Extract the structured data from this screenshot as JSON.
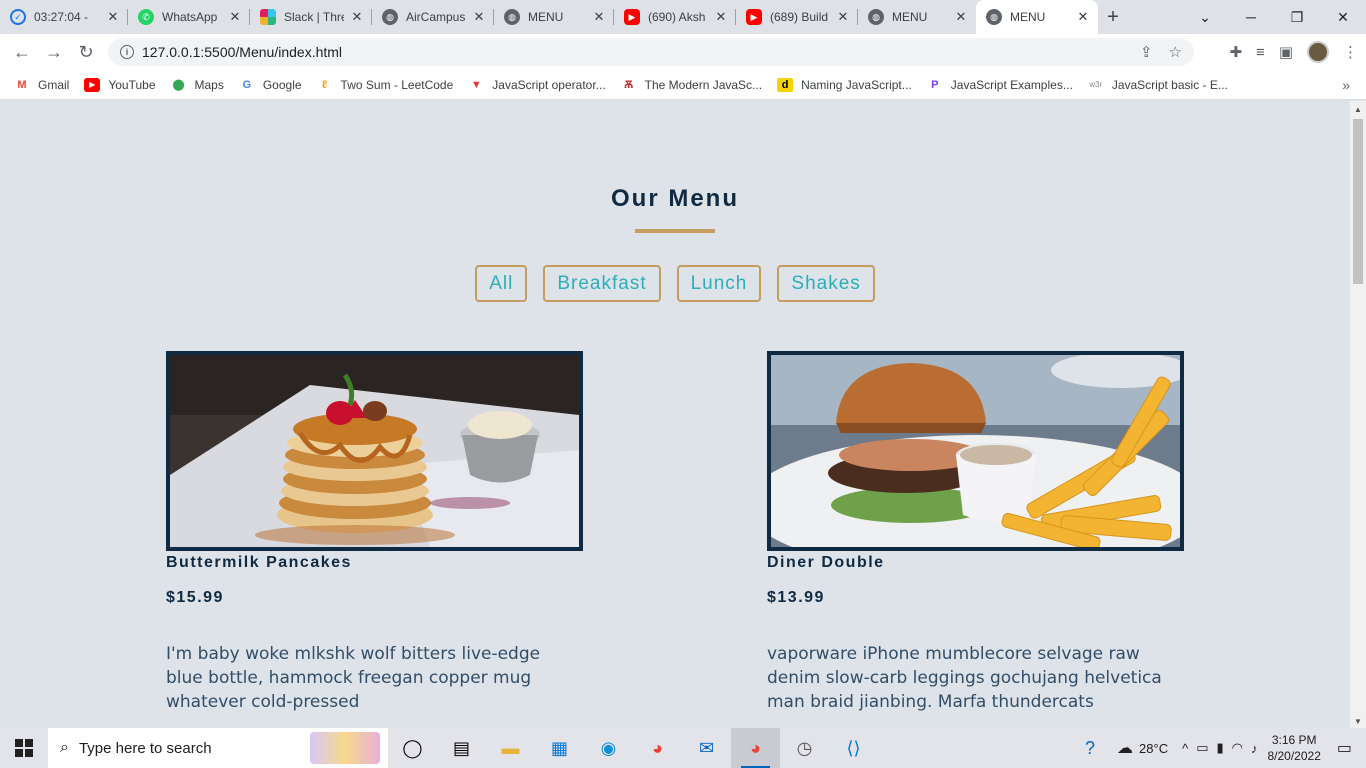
{
  "browser": {
    "tabs": [
      {
        "title": "03:27:04 -",
        "icon": "clock-check-icon",
        "color": "#1a73e8",
        "active": false
      },
      {
        "title": "WhatsApp",
        "icon": "whatsapp-icon",
        "color": "#25d366",
        "active": false
      },
      {
        "title": "Slack | Thre",
        "icon": "slack-icon",
        "color": "#e01e5a",
        "active": false
      },
      {
        "title": "AirCampus",
        "icon": "globe-icon",
        "color": "#5f6368",
        "active": false
      },
      {
        "title": "MENU",
        "icon": "globe-icon",
        "color": "#5f6368",
        "active": false
      },
      {
        "title": "(690) Aksh",
        "icon": "youtube-icon",
        "color": "#ff0000",
        "active": false
      },
      {
        "title": "(689) Build",
        "icon": "youtube-icon",
        "color": "#ff0000",
        "active": false
      },
      {
        "title": "MENU",
        "icon": "globe-icon",
        "color": "#5f6368",
        "active": false
      },
      {
        "title": "MENU",
        "icon": "globe-icon",
        "color": "#5f6368",
        "active": true
      }
    ],
    "url": "127.0.0.1:5500/Menu/index.html",
    "bookmarks": [
      {
        "label": "Gmail",
        "icon": "gmail-icon",
        "color": "#ea4335"
      },
      {
        "label": "YouTube",
        "icon": "youtube-icon",
        "color": "#ff0000"
      },
      {
        "label": "Maps",
        "icon": "maps-pin-icon",
        "color": "#34a853"
      },
      {
        "label": "Google",
        "icon": "google-icon",
        "color": "#4285f4"
      },
      {
        "label": "Two Sum - LeetCode",
        "icon": "leetcode-icon",
        "color": "#ffa116"
      },
      {
        "label": "JavaScript operator...",
        "icon": "triangle-logo-icon",
        "color": "#e53935"
      },
      {
        "label": "The Modern JavaSc...",
        "icon": "tower-icon",
        "color": "#c62828"
      },
      {
        "label": "Naming JavaScript...",
        "icon": "d-logo-icon",
        "color": "#f5d400"
      },
      {
        "label": "JavaScript Examples...",
        "icon": "p-logo-icon",
        "color": "#7e3ff2"
      },
      {
        "label": "JavaScript basic - E...",
        "icon": "w3r-icon",
        "color": "#888888"
      }
    ]
  },
  "page": {
    "title": "Our Menu",
    "accent": "#c59d5f",
    "filters": [
      "All",
      "Breakfast",
      "Lunch",
      "Shakes"
    ],
    "items": [
      {
        "name": "Buttermilk Pancakes",
        "price": "$15.99",
        "desc": "I'm baby woke mlkshk wolf bitters live-edge blue bottle, hammock freegan copper mug whatever cold-pressed",
        "image": "pancakes-photo"
      },
      {
        "name": "Diner Double",
        "price": "$13.99",
        "desc": "vaporware iPhone mumblecore selvage raw denim slow-carb leggings gochujang helvetica man braid jianbing. Marfa thundercats",
        "image": "burger-fries-photo"
      }
    ]
  },
  "taskbar": {
    "search_placeholder": "Type here to search",
    "temperature": "28°C",
    "time": "3:16 PM",
    "date": "8/20/2022"
  }
}
